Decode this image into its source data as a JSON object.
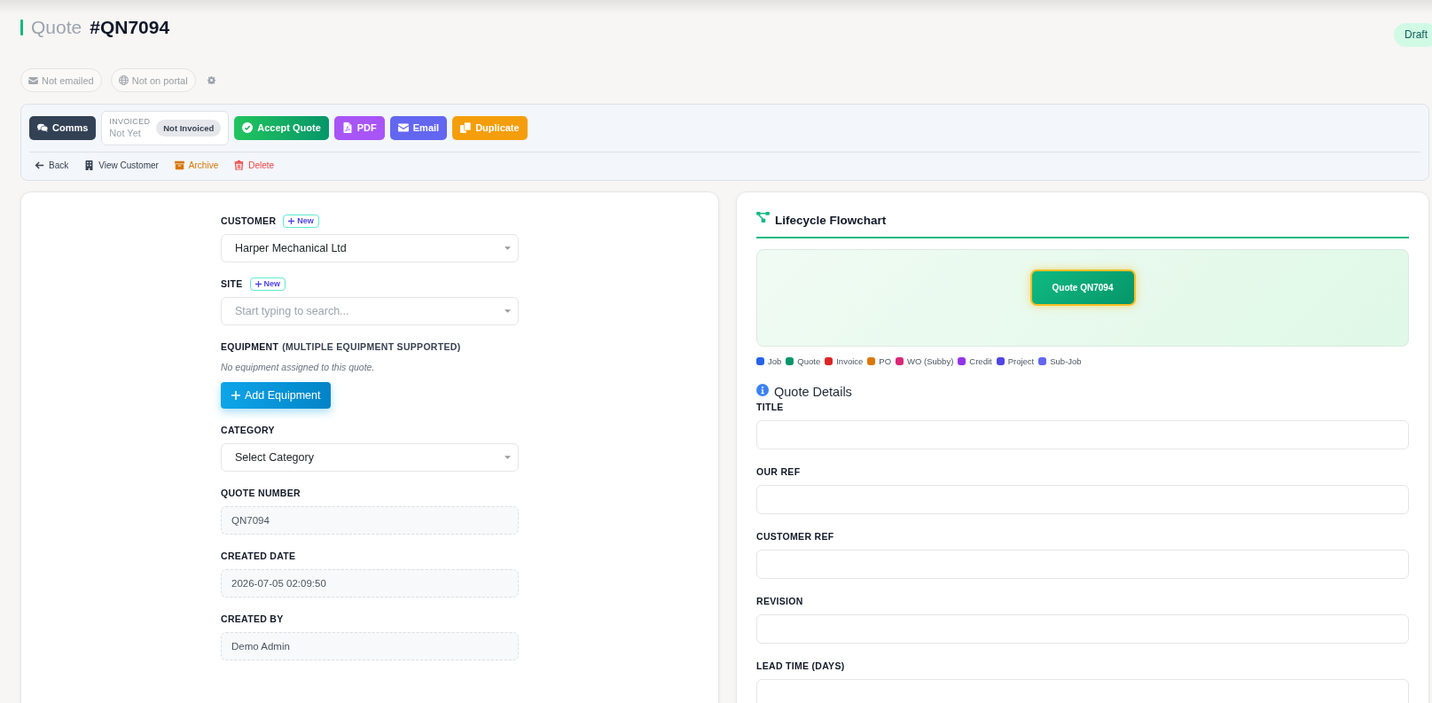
{
  "header": {
    "title_prefix": "Quote",
    "quote_number": "#QN7094",
    "status": "Draft"
  },
  "indicators": [
    {
      "kind": "email",
      "label": "Not emailed"
    },
    {
      "kind": "portal",
      "label": "Not on portal"
    }
  ],
  "toolbar": {
    "comms_button": "Comms",
    "invoice_status": {
      "label": "INVOICED",
      "value": "Not Yet",
      "badge": "Not Invoiced"
    },
    "actions": [
      {
        "kind": "accept",
        "label": "Accept Quote"
      },
      {
        "kind": "pdf",
        "label": "PDF"
      },
      {
        "kind": "email",
        "label": "Email"
      },
      {
        "kind": "duplicate",
        "label": "Duplicate"
      }
    ],
    "links": [
      {
        "kind": "back",
        "label": "Back"
      },
      {
        "kind": "customer",
        "label": "View Customer"
      },
      {
        "kind": "archive",
        "label": "Archive"
      },
      {
        "kind": "delete",
        "label": "Delete"
      }
    ]
  },
  "details_form": {
    "fields": [
      {
        "kind": "select",
        "label": "CUSTOMER",
        "new_button": "New",
        "value": "Harper Mechanical Ltd"
      },
      {
        "kind": "select",
        "label": "SITE",
        "new_button": "New",
        "placeholder": "Start typing to search..."
      },
      {
        "kind": "equipment",
        "label": "EQUIPMENT",
        "label_note": "(MULTIPLE EQUIPMENT SUPPORTED)",
        "empty_text": "No equipment assigned to this quote.",
        "button": "Add Equipment"
      },
      {
        "kind": "select",
        "label": "CATEGORY",
        "value": "Select Category"
      },
      {
        "kind": "readonly",
        "label": "QUOTE NUMBER",
        "value": "QN7094"
      },
      {
        "kind": "readonly",
        "label": "CREATED DATE",
        "value": "2026-07-05 02:09:50"
      },
      {
        "kind": "readonly",
        "label": "CREATED BY",
        "value": "Demo Admin"
      }
    ]
  },
  "lifecycle": {
    "title": "Lifecycle Flowchart",
    "nodes": [
      {
        "label": "Quote QN7094",
        "current": true
      }
    ],
    "legend": [
      {
        "label": "Job",
        "color": "#2563eb"
      },
      {
        "label": "Quote",
        "color": "#059669"
      },
      {
        "label": "Invoice",
        "color": "#dc2626"
      },
      {
        "label": "PO",
        "color": "#d97706"
      },
      {
        "label": "WO (Subby)",
        "color": "#db2777"
      },
      {
        "label": "Credit",
        "color": "#9333ea"
      },
      {
        "label": "Project",
        "color": "#4f46e5"
      },
      {
        "label": "Sub-Job",
        "color": "#6366f1"
      }
    ]
  },
  "quote_details": {
    "title": "Quote Details",
    "fields": [
      {
        "label": "TITLE"
      },
      {
        "label": "OUR REF"
      },
      {
        "label": "CUSTOMER REF"
      },
      {
        "label": "REVISION"
      },
      {
        "label": "LEAD TIME (DAYS)"
      }
    ]
  }
}
